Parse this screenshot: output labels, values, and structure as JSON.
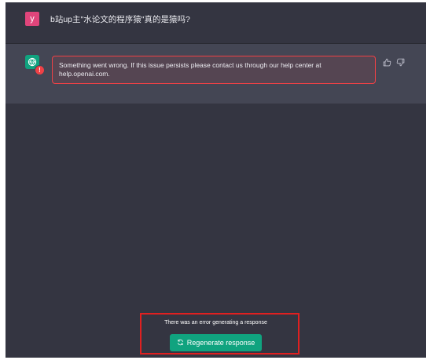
{
  "user_message": {
    "avatar_letter": "y",
    "text": "b站up主\"水论文的程序猿\"真的是猿吗?"
  },
  "assistant_message": {
    "avatar_icon": "openai-logo-icon",
    "error_badge": "!",
    "error_text": "Something went wrong. If this issue persists please contact us through our help center at help.openai.com."
  },
  "feedback": {
    "up_icon": "thumbs-up-icon",
    "down_icon": "thumbs-down-icon"
  },
  "footer": {
    "error_note": "There was an error generating a response",
    "regenerate_label": "Regenerate response"
  },
  "colors": {
    "background": "#343541",
    "assistant_bg": "#444654",
    "accent": "#10a37f",
    "error": "#ef4146",
    "user_avatar": "#e0457b",
    "highlight": "#e02020"
  }
}
